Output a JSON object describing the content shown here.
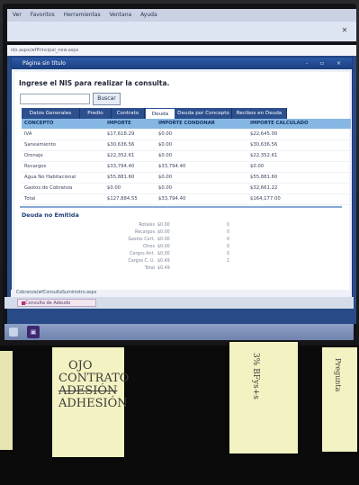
{
  "browser": {
    "menu": [
      "Ver",
      "Favoritos",
      "Herramientas",
      "Ventana",
      "Ayuda"
    ],
    "address": "idx.aspx/wfPrincipal_new.aspx",
    "status_url": "Cobranza/wfConsultaSuministro.aspx",
    "task_label": "Consulta de Adeudo"
  },
  "window": {
    "title": "Página sin título",
    "controls": "- ▫ ×"
  },
  "form": {
    "nis_label": "Ingrese el NIS para realizar la consulta.",
    "search_button": "Buscar"
  },
  "tabs": [
    "Datos Generales",
    "Predio",
    "Contrato",
    "Deuda",
    "Deuda por Concepto",
    "Recibos en Deuda"
  ],
  "active_tab": "Deuda",
  "table": {
    "headers": [
      "CONCEPTO",
      "IMPORTE",
      "IMPORTE CONDONAR",
      "IMPORTE CALCULADO"
    ],
    "rows": [
      [
        "IVA",
        "$17,618.29",
        "$0.00",
        "$22,645.00"
      ],
      [
        "Saneamiento",
        "$30,636.56",
        "$0.00",
        "$30,636.56"
      ],
      [
        "Drenaje",
        "$22,352.61",
        "$0.00",
        "$22,352.61"
      ],
      [
        "Recargos",
        "$33,794.40",
        "$33,794.40",
        "$0.00"
      ],
      [
        "Agua No Habitacional",
        "$55,881.60",
        "$0.00",
        "$55,881.60"
      ],
      [
        "Gastos de Cobranza",
        "$0.00",
        "$0.00",
        "$32,661.22"
      ],
      [
        "Total",
        "$127,884.55",
        "$33,794.40",
        "$164,177.00"
      ]
    ]
  },
  "no_emitida": {
    "title": "Deuda no Emitida",
    "rows": [
      [
        "Rotales",
        "$0.00",
        "0"
      ],
      [
        "Recargos",
        "$0.00",
        "0"
      ],
      [
        "Gastos Cert.",
        "$0.00",
        "0"
      ],
      [
        "Otros",
        "$0.00",
        "0"
      ],
      [
        "Cargos Ant.",
        "$0.00",
        "0"
      ],
      [
        "Cargos C. U.",
        "$0.49",
        "1"
      ],
      [
        "Total",
        "$0.49",
        ""
      ]
    ]
  },
  "notes": [
    {
      "lines": [
        "OJO",
        "CONTRATO",
        "ADESIÓN",
        "ADHESIÓN"
      ]
    },
    {
      "text": "3% BFys+s"
    },
    {
      "text": "Pregunta"
    }
  ]
}
